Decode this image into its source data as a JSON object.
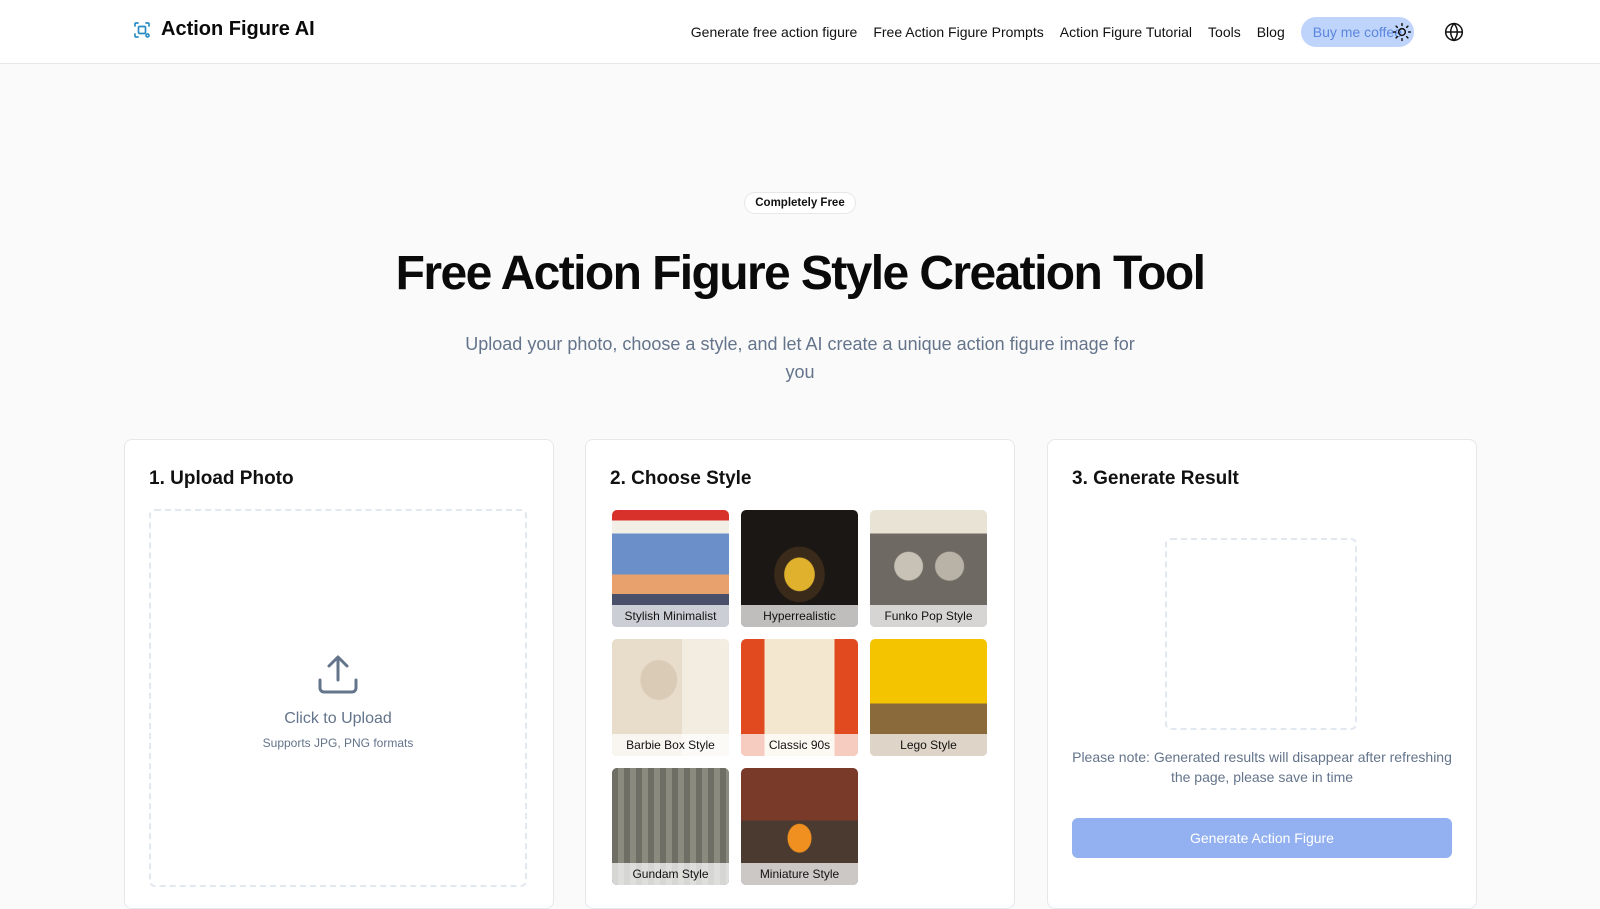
{
  "header": {
    "brand_name": "Action Figure AI",
    "nav": [
      {
        "label": "Generate free action figure"
      },
      {
        "label": "Free Action Figure Prompts"
      },
      {
        "label": "Action Figure Tutorial"
      },
      {
        "label": "Tools"
      },
      {
        "label": "Blog"
      }
    ],
    "coffee_label": "Buy me coffee",
    "theme_icon": "sun-icon",
    "language_icon": "globe-icon"
  },
  "hero": {
    "badge": "Completely Free",
    "title": "Free Action Figure Style Creation Tool",
    "subtitle": "Upload your photo, choose a style, and let AI create a unique action figure image for you"
  },
  "upload": {
    "title": "1. Upload Photo",
    "cta": "Click to Upload",
    "formats": "Supports JPG, PNG formats",
    "icon": "upload-icon"
  },
  "style": {
    "title": "2. Choose Style",
    "items": [
      {
        "label": "Stylish Minimalist"
      },
      {
        "label": "Hyperrealistic"
      },
      {
        "label": "Funko Pop Style"
      },
      {
        "label": "Barbie Box Style"
      },
      {
        "label": "Classic 90s"
      },
      {
        "label": "Lego Style"
      },
      {
        "label": "Gundam Style"
      },
      {
        "label": "Miniature Style"
      }
    ]
  },
  "result": {
    "title": "3. Generate Result",
    "note": "Please note: Generated results will disappear after refreshing the page, please save in time",
    "button": "Generate Action Figure"
  },
  "colors": {
    "accent": "#93b1f0",
    "coffee_bg": "#bfd4fb",
    "muted_text": "#64748b",
    "brand_icon": "#2b8dc4"
  }
}
